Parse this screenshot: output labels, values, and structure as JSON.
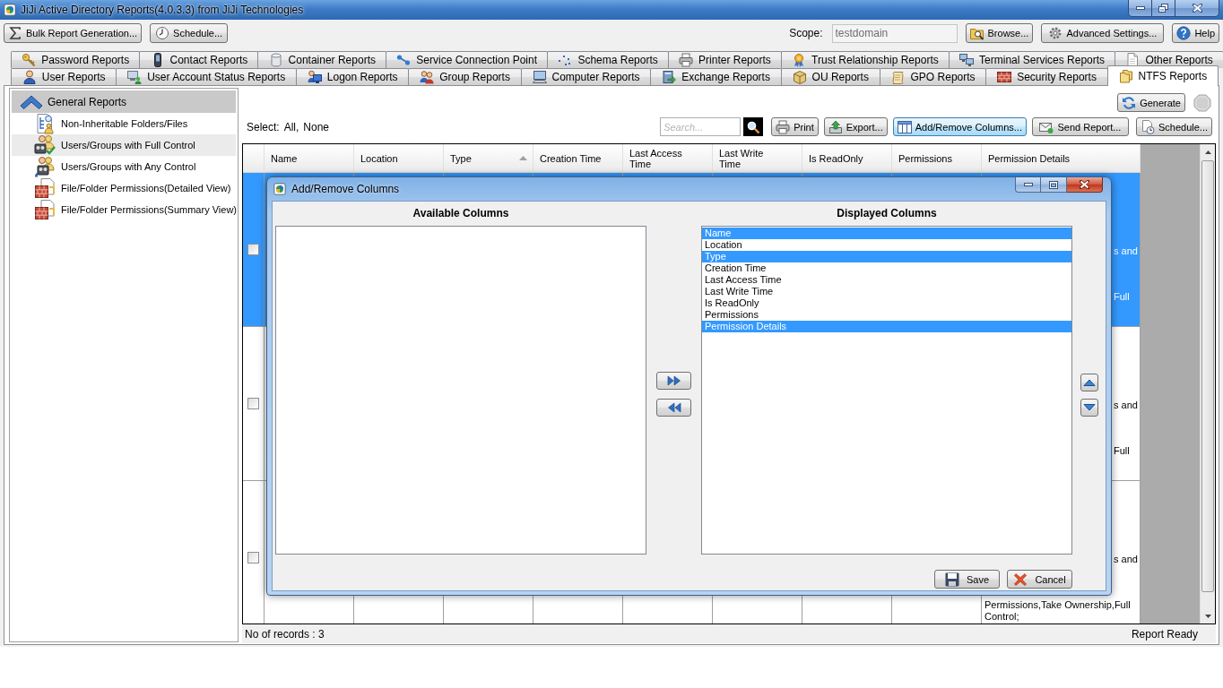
{
  "window": {
    "title": "JiJi Active Directory Reports(4.0.3.3) from JiJi Technologies"
  },
  "toolbar": {
    "left_buttons": [
      "Bulk Report Generation...",
      "Schedule..."
    ],
    "scope": {
      "label": "Scope:",
      "value": "testdomain",
      "disabled": true
    },
    "right_buttons": [
      "Browse...",
      "Advanced Settings...",
      "Help"
    ]
  },
  "tabs": {
    "back_row": [
      {
        "label": "Password Reports",
        "selected": false
      },
      {
        "label": "Contact Reports",
        "selected": false
      },
      {
        "label": "Container Reports",
        "selected": false
      },
      {
        "label": "Service Connection Point",
        "selected": false
      },
      {
        "label": "Schema Reports",
        "selected": false
      },
      {
        "label": "Printer Reports",
        "selected": false
      },
      {
        "label": "Trust Relationship Reports",
        "selected": false
      },
      {
        "label": "Terminal Services Reports",
        "selected": false
      },
      {
        "label": "Other Reports",
        "selected": false
      }
    ],
    "front_row": [
      {
        "label": "User Reports",
        "selected": false
      },
      {
        "label": "User Account Status Reports",
        "selected": false
      },
      {
        "label": "Logon Reports",
        "selected": false
      },
      {
        "label": "Group Reports",
        "selected": false
      },
      {
        "label": "Computer Reports",
        "selected": false
      },
      {
        "label": "Exchange Reports",
        "selected": false
      },
      {
        "label": "OU Reports",
        "selected": false
      },
      {
        "label": "GPO Reports",
        "selected": false
      },
      {
        "label": "Security Reports",
        "selected": false
      },
      {
        "label": "NTFS Reports",
        "selected": true
      }
    ]
  },
  "sidebar": {
    "group": {
      "label": "General Reports",
      "expanded": true,
      "items": [
        {
          "label": "Non-Inheritable Folders/Files",
          "selected": false
        },
        {
          "label": "Users/Groups with Full Control",
          "selected": true
        },
        {
          "label": "Users/Groups with Any Control",
          "selected": false
        },
        {
          "label": "File/Folder Permissions(Detailed View)",
          "selected": false
        },
        {
          "label": "File/Folder Permissions(Summary View)",
          "selected": false
        }
      ]
    }
  },
  "report": {
    "generate": "Generate",
    "stop": {
      "disabled": true
    },
    "select": {
      "label": "Select:",
      "options": [
        "All,",
        "None"
      ]
    },
    "search": {
      "placeholder": "Search..."
    },
    "actions": [
      {
        "label": "Print",
        "focused": false
      },
      {
        "label": "Export...",
        "focused": false
      },
      {
        "label": "Add/Remove Columns...",
        "focused": true
      },
      {
        "label": "Send Report...",
        "focused": false
      },
      {
        "label": "Schedule...",
        "focused": false
      }
    ],
    "table": {
      "columns": [
        {
          "label": "Name",
          "sorted": false
        },
        {
          "label": "Location",
          "sorted": false
        },
        {
          "label": "Type",
          "sorted": true
        },
        {
          "label": "Creation Time",
          "sorted": false
        },
        {
          "label": "Last Access Time",
          "sorted": false
        },
        {
          "label": "Last Write Time",
          "sorted": false
        },
        {
          "label": "Is ReadOnly",
          "sorted": false
        },
        {
          "label": "Permissions",
          "sorted": false
        },
        {
          "label": "Permission Details",
          "sorted": false
        }
      ],
      "rows": [
        {
          "selected": true,
          "checked": false,
          "permission_details": [
            {
              "kind": "peek",
              "text": "s and"
            },
            {
              "kind": "peek",
              "text": "Full"
            }
          ]
        },
        {
          "selected": false,
          "checked": false,
          "permission_details": [
            {
              "kind": "peek",
              "text": "s and"
            },
            {
              "kind": "peek",
              "text": "Full"
            }
          ]
        },
        {
          "selected": false,
          "checked": false,
          "permission_details": [
            {
              "kind": "peek",
              "text": "s and"
            },
            {
              "kind": "line",
              "text": "Permissions,Take Ownership,Full Control;"
            }
          ]
        }
      ]
    },
    "status": {
      "records": "No of records : 3",
      "state": "Report Ready"
    }
  },
  "dialog": {
    "title": "Add/Remove Columns",
    "available": {
      "heading": "Available Columns"
    },
    "displayed": {
      "heading": "Displayed Columns",
      "items": [
        {
          "label": "Name",
          "selected": true
        },
        {
          "label": "Location",
          "selected": false
        },
        {
          "label": "Type",
          "selected": true
        },
        {
          "label": "Creation Time",
          "selected": false
        },
        {
          "label": "Last Access Time",
          "selected": false
        },
        {
          "label": "Last Write Time",
          "selected": false
        },
        {
          "label": "Is ReadOnly",
          "selected": false
        },
        {
          "label": "Permissions",
          "selected": false
        },
        {
          "label": "Permission Details",
          "selected": true
        }
      ]
    },
    "buttons": [
      "Save",
      "Cancel"
    ]
  }
}
